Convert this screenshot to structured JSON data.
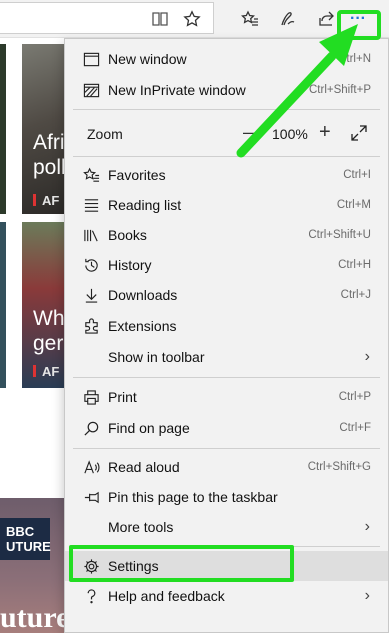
{
  "toolbar": {
    "icons": [
      "reading-view-icon",
      "favorite-star-icon",
      "favorites-hub-icon",
      "web-note-icon",
      "share-icon",
      "more-icon"
    ],
    "more_label": "···"
  },
  "tiles": {
    "t1_text": "Afri\npoll",
    "t1_src": "AF",
    "t2_text": "Wh\nger",
    "t2_src": "AF",
    "bbc_top": "BBC",
    "bbc_bottom": "UTURE",
    "planet": "uture Planet"
  },
  "menu": {
    "new_window": "New window",
    "new_window_sc": "Ctrl+N",
    "inprivate": "New InPrivate window",
    "inprivate_sc": "Ctrl+Shift+P",
    "zoom": "Zoom",
    "zoom_minus": "—",
    "zoom_value": "100%",
    "zoom_plus": "+",
    "favorites": "Favorites",
    "favorites_sc": "Ctrl+I",
    "reading_list": "Reading list",
    "reading_list_sc": "Ctrl+M",
    "books": "Books",
    "books_sc": "Ctrl+Shift+U",
    "history": "History",
    "history_sc": "Ctrl+H",
    "downloads": "Downloads",
    "downloads_sc": "Ctrl+J",
    "extensions": "Extensions",
    "show_in_toolbar": "Show in toolbar",
    "print": "Print",
    "print_sc": "Ctrl+P",
    "find": "Find on page",
    "find_sc": "Ctrl+F",
    "read_aloud": "Read aloud",
    "read_aloud_sc": "Ctrl+Shift+G",
    "pin": "Pin this page to the taskbar",
    "more_tools": "More tools",
    "settings": "Settings",
    "help": "Help and feedback"
  },
  "colors": {
    "annotation": "#22dd22",
    "menu_bg": "#f2f2f2",
    "highlight": "#dedede"
  }
}
